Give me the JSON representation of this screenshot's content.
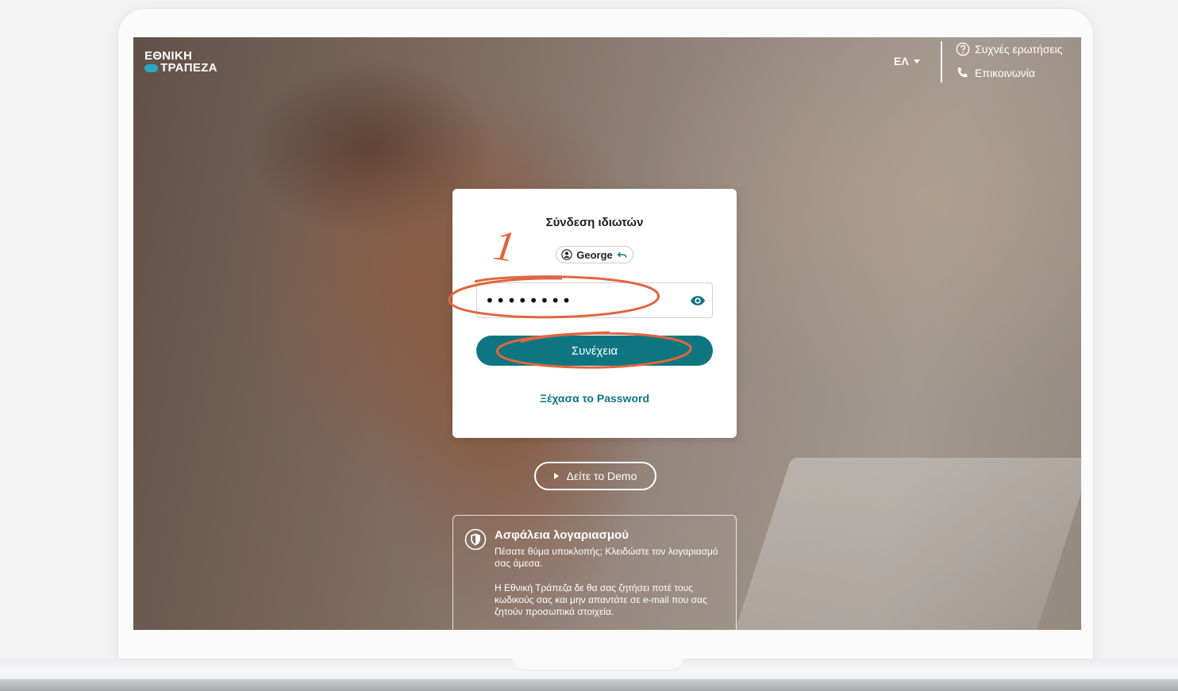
{
  "header": {
    "brand_line1": "ΕΘΝΙΚΗ",
    "brand_line2": "ΤΡΑΠΕΖΑ",
    "language": "ΕΛ",
    "faq_label": "Συχνές ερωτήσεις",
    "contact_label": "Επικοινωνία"
  },
  "login": {
    "title": "Σύνδεση ιδιωτών",
    "username": "George",
    "password_value": "••••••••",
    "continue_label": "Συνέχεια",
    "forgot_label": "Ξέχασα το Password"
  },
  "annotation": {
    "step_number": "1",
    "color": "#e0663f"
  },
  "demo": {
    "label": "Δείτε το Demo"
  },
  "security": {
    "title": "Ασφάλεια λογαριασμού",
    "line1": "Πέσατε θύμα υποκλοπής; Κλειδώστε τον λογαριασμό σας άμεσα.",
    "line2": "Η Εθνική Τράπεζα δε θα σας ζητήσει ποτέ τους κωδικούς σας και μην απαντάτε σε e-mail που σας ζητούν προσωπικά στοιχεία."
  },
  "colors": {
    "primary": "#0e7680",
    "brand_accent": "#2aa9c4"
  },
  "icons": [
    "help-circle-icon",
    "phone-icon",
    "user-circle-icon",
    "undo-icon",
    "eye-icon",
    "play-icon",
    "shield-icon"
  ]
}
